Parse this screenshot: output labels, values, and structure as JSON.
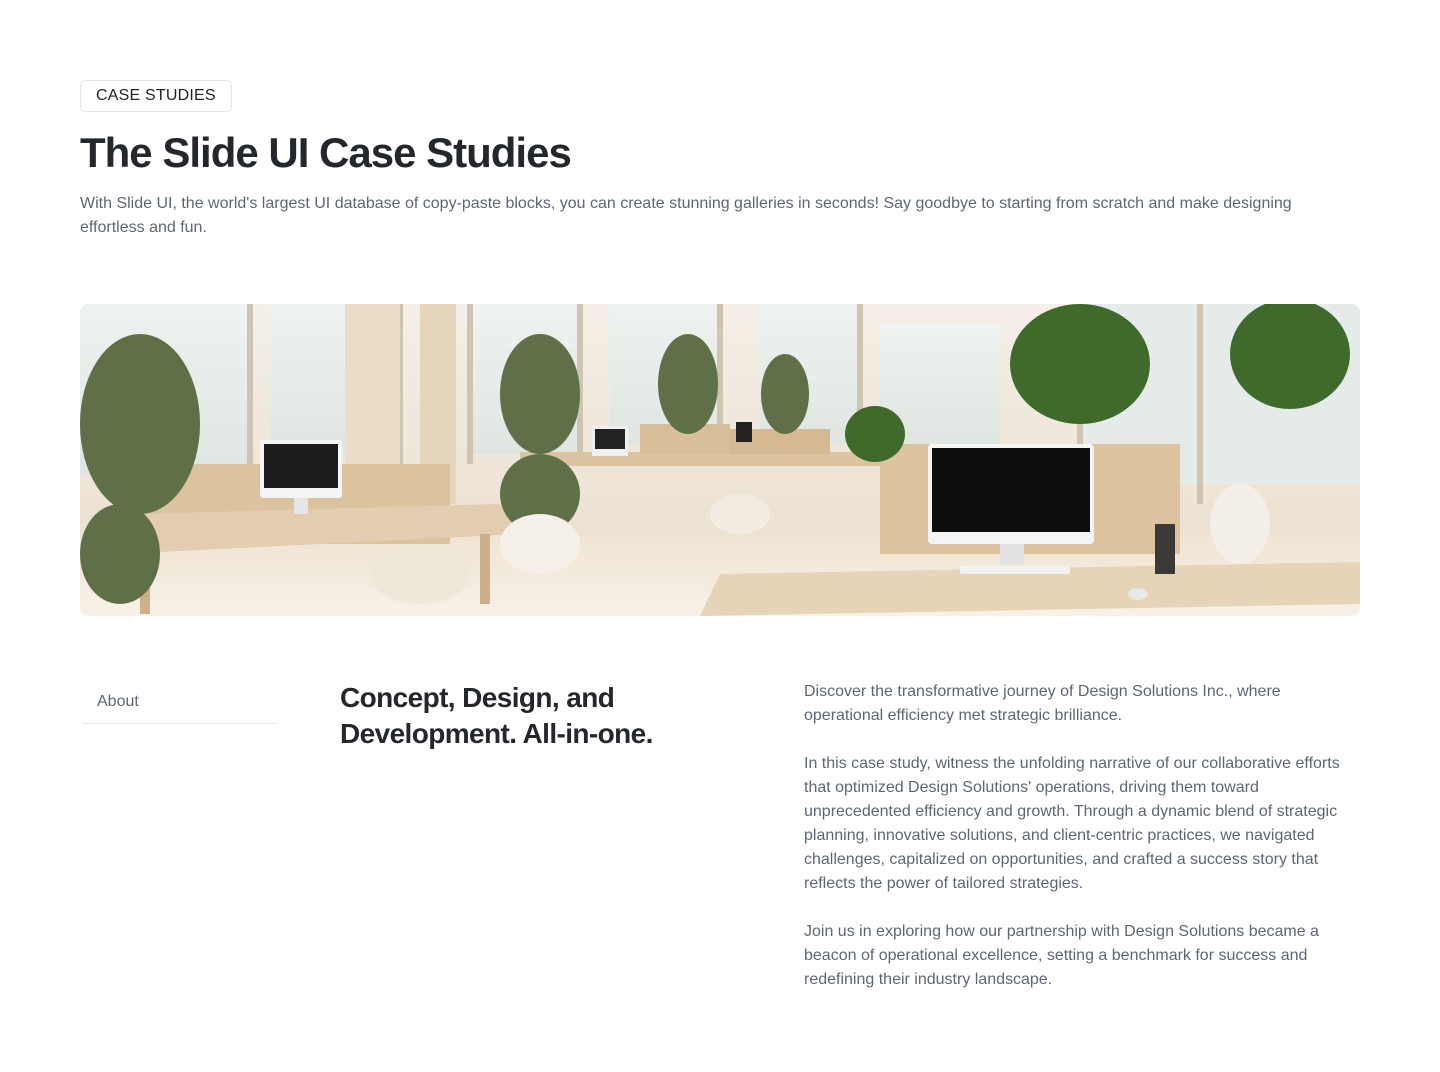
{
  "header": {
    "badge": "CASE STUDIES",
    "title": "The Slide UI Case Studies",
    "description": "With Slide UI, the world's largest UI database of copy-paste blocks, you can create stunning galleries in seconds! Say goodbye to starting from scratch and make designing effortless and fun."
  },
  "hero": {
    "image": "office-workspace-image"
  },
  "sidebar": {
    "tabs": [
      {
        "label": "About"
      }
    ]
  },
  "content": {
    "heading": "Concept, Design, and Development. All-in-one.",
    "paragraphs": [
      "Discover the transformative journey of Design Solutions Inc., where operational efficiency met strategic brilliance.",
      " In this case study, witness the unfolding narrative of our collaborative efforts that optimized Design Solutions' operations, driving them toward unprecedented efficiency and growth. Through a dynamic blend of strategic planning, innovative solutions, and client-centric practices, we navigated challenges, capitalized on opportunities, and crafted a success story that reflects the power of tailored strategies.",
      " Join us in exploring how our partnership with Design Solutions became a beacon of operational excellence, setting a benchmark for success and redefining their industry landscape."
    ]
  },
  "colors": {
    "text_primary": "#24272b",
    "text_muted": "#5f6670",
    "border": "#e5e7eb"
  }
}
